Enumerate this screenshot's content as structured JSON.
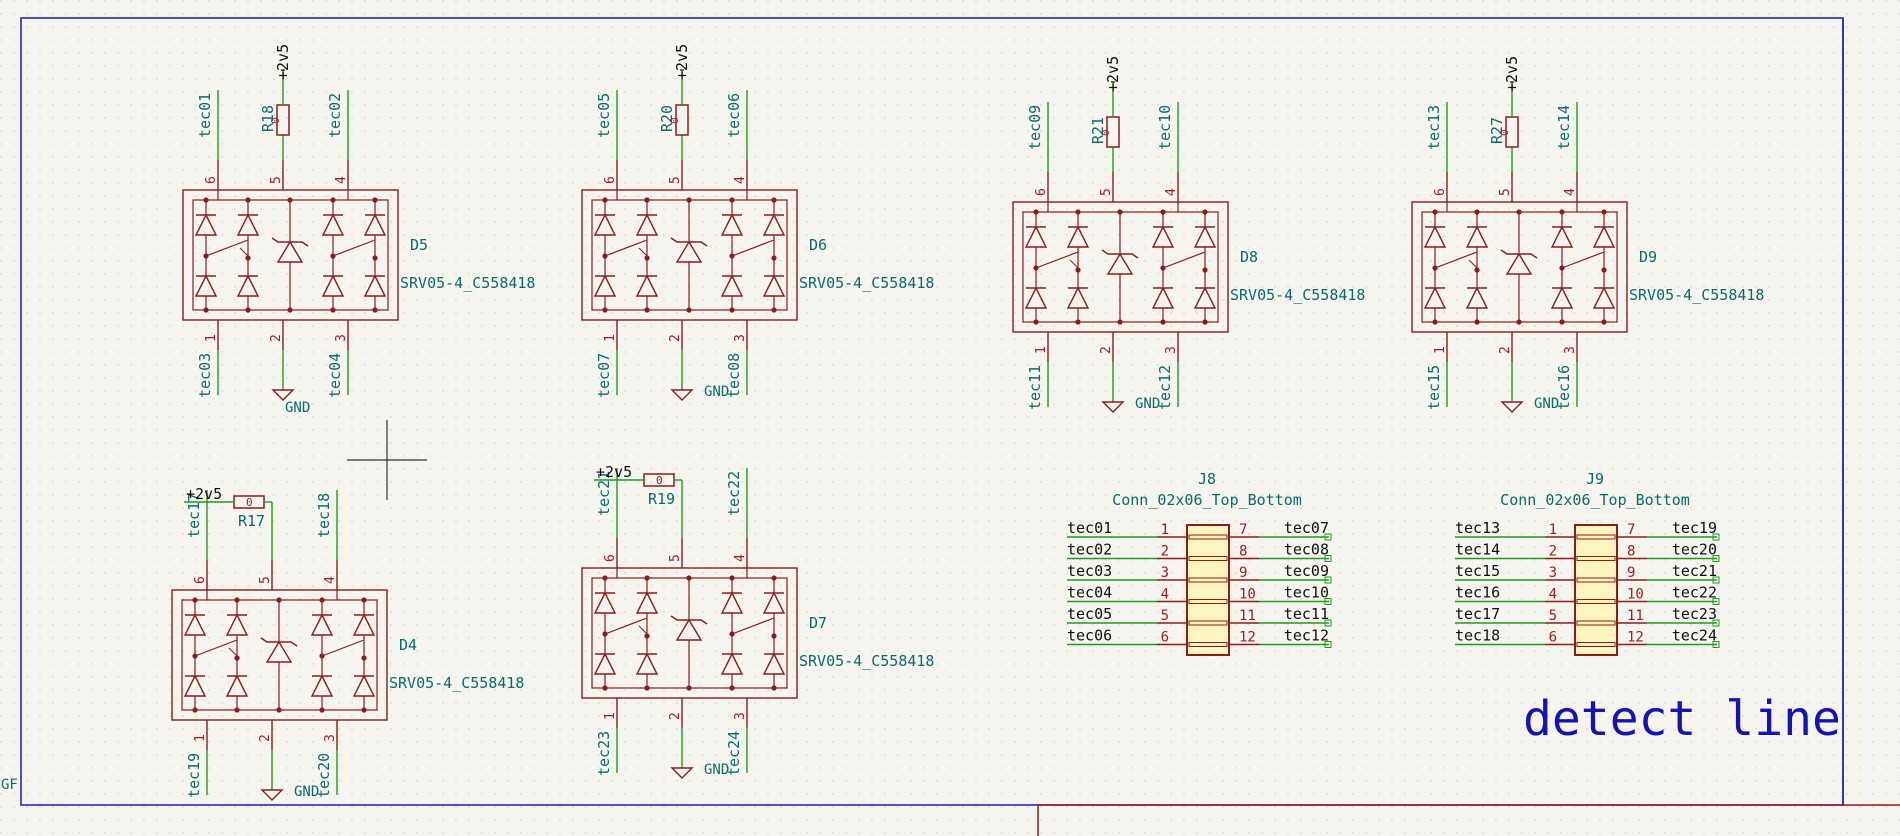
{
  "colors": {
    "background": "#f5f4ef",
    "frame": "#1a1ab8",
    "wire": "#1f9c1f",
    "body": "#8b1c1c",
    "body_fill": "#fdf5c0",
    "net_label": "#0a6b6b",
    "pin_number": "#a41c1c",
    "title": "#1414b4"
  },
  "power_labels": {
    "vcc": "+2v5",
    "gnd": "GND"
  },
  "tvs_blocks": [
    {
      "ref": "D5",
      "value": "SRV05-4_C558418",
      "res_ref": "R18",
      "res_value": "0",
      "pin_labels": [
        "1",
        "2",
        "3",
        "4",
        "5",
        "6"
      ],
      "nets": [
        "tec03",
        "tec04",
        "tec01",
        "tec02"
      ]
    },
    {
      "ref": "D6",
      "value": "SRV05-4_C558418",
      "res_ref": "R20",
      "res_value": "0",
      "pin_labels": [
        "1",
        "2",
        "3",
        "4",
        "5",
        "6"
      ],
      "nets": [
        "tec07",
        "tec08",
        "tec05",
        "tec06"
      ]
    },
    {
      "ref": "D8",
      "value": "SRV05-4_C558418",
      "res_ref": "R21",
      "res_value": "0",
      "pin_labels": [
        "1",
        "2",
        "3",
        "4",
        "5",
        "6"
      ],
      "nets": [
        "tec11",
        "tec12",
        "tec09",
        "tec10"
      ]
    },
    {
      "ref": "D9",
      "value": "SRV05-4_C558418",
      "res_ref": "R27",
      "res_value": "0",
      "pin_labels": [
        "1",
        "2",
        "3",
        "4",
        "5",
        "6"
      ],
      "nets": [
        "tec15",
        "tec16",
        "tec13",
        "tec14"
      ]
    },
    {
      "ref": "D4",
      "value": "SRV05-4_C558418",
      "res_ref": "R17",
      "res_value": "0",
      "pin_labels": [
        "1",
        "2",
        "3",
        "4",
        "5",
        "6"
      ],
      "nets": [
        "tec19",
        "tec20",
        "tec17",
        "tec18"
      ]
    },
    {
      "ref": "D7",
      "value": "SRV05-4_C558418",
      "res_ref": "R19",
      "res_value": "0",
      "pin_labels": [
        "1",
        "2",
        "3",
        "4",
        "5",
        "6"
      ],
      "nets": [
        "tec23",
        "tec24",
        "tec21",
        "tec22"
      ]
    }
  ],
  "connectors": [
    {
      "ref": "J8",
      "value": "Conn_02x06_Top_Bottom",
      "left_pins": [
        "1",
        "2",
        "3",
        "4",
        "5",
        "6"
      ],
      "right_pins": [
        "7",
        "8",
        "9",
        "10",
        "11",
        "12"
      ],
      "left_nets": [
        "tec01",
        "tec02",
        "tec03",
        "tec04",
        "tec05",
        "tec06"
      ],
      "right_nets": [
        "tec07",
        "tec08",
        "tec09",
        "tec10",
        "tec11",
        "tec12"
      ]
    },
    {
      "ref": "J9",
      "value": "Conn_02x06_Top_Bottom",
      "left_pins": [
        "1",
        "2",
        "3",
        "4",
        "5",
        "6"
      ],
      "right_pins": [
        "7",
        "8",
        "9",
        "10",
        "11",
        "12"
      ],
      "left_nets": [
        "tec13",
        "tec14",
        "tec15",
        "tec16",
        "tec17",
        "tec18"
      ],
      "right_nets": [
        "tec19",
        "tec20",
        "tec21",
        "tec22",
        "tec23",
        "tec24"
      ]
    }
  ],
  "title_text": "detect line",
  "edge_text": "GF"
}
